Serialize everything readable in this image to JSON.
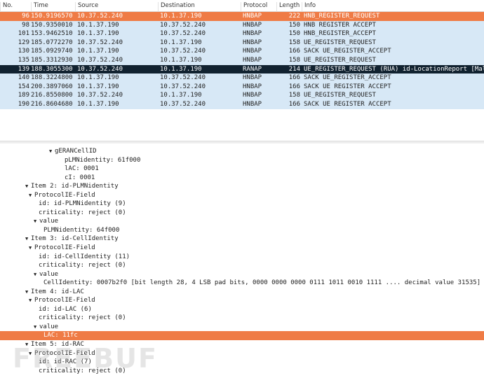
{
  "columns": [
    "No.",
    "Time",
    "Source",
    "Destination",
    "Protocol",
    "Length",
    "Info"
  ],
  "packets": [
    {
      "no": "96",
      "time": "150.9196570",
      "src": "10.37.52.240",
      "dst": "10.1.37.190",
      "proto": "HNBAP",
      "len": "222",
      "info": "HNB_REGISTER_REQUEST",
      "state": "selected"
    },
    {
      "no": "98",
      "time": "150.9350010",
      "src": "10.1.37.190",
      "dst": "10.37.52.240",
      "proto": "HNBAP",
      "len": "150",
      "info": "HNB REGISTER ACCEPT",
      "state": ""
    },
    {
      "no": "101",
      "time": "153.9462510",
      "src": "10.1.37.190",
      "dst": "10.37.52.240",
      "proto": "HNBAP",
      "len": "150",
      "info": "HNB_REGISTER_ACCEPT",
      "state": ""
    },
    {
      "no": "129",
      "time": "185.0772270",
      "src": "10.37.52.240",
      "dst": "10.1.37.190",
      "proto": "HNBAP",
      "len": "158",
      "info": "UE_REGISTER_REQUEST",
      "state": ""
    },
    {
      "no": "130",
      "time": "185.0929740",
      "src": "10.1.37.190",
      "dst": "10.37.52.240",
      "proto": "HNBAP",
      "len": "166",
      "info": "SACK UE_REGISTER_ACCEPT",
      "state": ""
    },
    {
      "no": "135",
      "time": "185.3312930",
      "src": "10.37.52.240",
      "dst": "10.1.37.190",
      "proto": "HNBAP",
      "len": "158",
      "info": "UE_REGISTER_REQUEST",
      "state": ""
    },
    {
      "no": "139",
      "time": "188.3055300",
      "src": "10.37.52.240",
      "dst": "10.1.37.190",
      "proto": "RANAP",
      "len": "214",
      "info": "UE_REGISTER_REQUEST (RUA) id-LocationReport [Malformed",
      "state": "dark"
    },
    {
      "no": "140",
      "time": "188.3224800",
      "src": "10.1.37.190",
      "dst": "10.37.52.240",
      "proto": "HNBAP",
      "len": "166",
      "info": "SACK UE_REGISTER_ACCEPT",
      "state": ""
    },
    {
      "no": "154",
      "time": "200.3897060",
      "src": "10.1.37.190",
      "dst": "10.37.52.240",
      "proto": "HNBAP",
      "len": "166",
      "info": "SACK UE REGISTER ACCEPT",
      "state": ""
    },
    {
      "no": "189",
      "time": "216.8550800",
      "src": "10.37.52.240",
      "dst": "10.1.37.190",
      "proto": "HNBAP",
      "len": "158",
      "info": "UE_REGISTER_REQUEST",
      "state": ""
    },
    {
      "no": "190",
      "time": "216.8604680",
      "src": "10.1.37.190",
      "dst": "10.37.52.240",
      "proto": "HNBAP",
      "len": "166",
      "info": "SACK UE REGISTER ACCEPT",
      "state": ""
    }
  ],
  "tree": [
    {
      "text": "gERANCellID",
      "indent": 4,
      "expand": true
    },
    {
      "text": "pLMNidentity: 61f000",
      "indent": 5,
      "expand": false
    },
    {
      "text": "lAC: 0001",
      "indent": 5,
      "expand": false
    },
    {
      "text": "cI: 0001",
      "indent": 5,
      "expand": false
    },
    {
      "text": "Item 2: id-PLMNidentity",
      "indent": 0,
      "expand": true
    },
    {
      "text": "ProtocolIE-Field",
      "indent": 1,
      "expand": true
    },
    {
      "text": "id: id-PLMNidentity (9)",
      "indent": 2,
      "expand": false
    },
    {
      "text": "criticality: reject (0)",
      "indent": 2,
      "expand": false
    },
    {
      "text": "value",
      "indent": 2,
      "expand": true
    },
    {
      "text": "PLMNidentity: 64f000",
      "indent": 3,
      "expand": false
    },
    {
      "text": "Item 3: id-CellIdentity",
      "indent": 0,
      "expand": true
    },
    {
      "text": "ProtocolIE-Field",
      "indent": 1,
      "expand": true
    },
    {
      "text": "id: id-CellIdentity (11)",
      "indent": 2,
      "expand": false
    },
    {
      "text": "criticality: reject (0)",
      "indent": 2,
      "expand": false
    },
    {
      "text": "value",
      "indent": 2,
      "expand": true
    },
    {
      "text": "CellIdentity: 0007b2f0 [bit length 28, 4 LSB pad bits, 0000 0000  0000 0111  1011 0010  1111 .... decimal value 31535]",
      "indent": 3,
      "expand": false
    },
    {
      "text": "Item 4: id-LAC",
      "indent": 0,
      "expand": true
    },
    {
      "text": "ProtocolIE-Field",
      "indent": 1,
      "expand": true
    },
    {
      "text": "id: id-LAC (6)",
      "indent": 2,
      "expand": false
    },
    {
      "text": "criticality: reject (0)",
      "indent": 2,
      "expand": false
    },
    {
      "text": "value",
      "indent": 2,
      "expand": true
    },
    {
      "text": "LAC: 11fc",
      "indent": 3,
      "expand": false,
      "highlight": true
    },
    {
      "text": "Item 5: id-RAC",
      "indent": 0,
      "expand": true
    },
    {
      "text": "ProtocolIE-Field",
      "indent": 1,
      "expand": true
    },
    {
      "text": "id: id-RAC (7)",
      "indent": 2,
      "expand": false
    },
    {
      "text": "criticality: reject (0)",
      "indent": 2,
      "expand": false
    }
  ],
  "watermark": "FREEBUF"
}
